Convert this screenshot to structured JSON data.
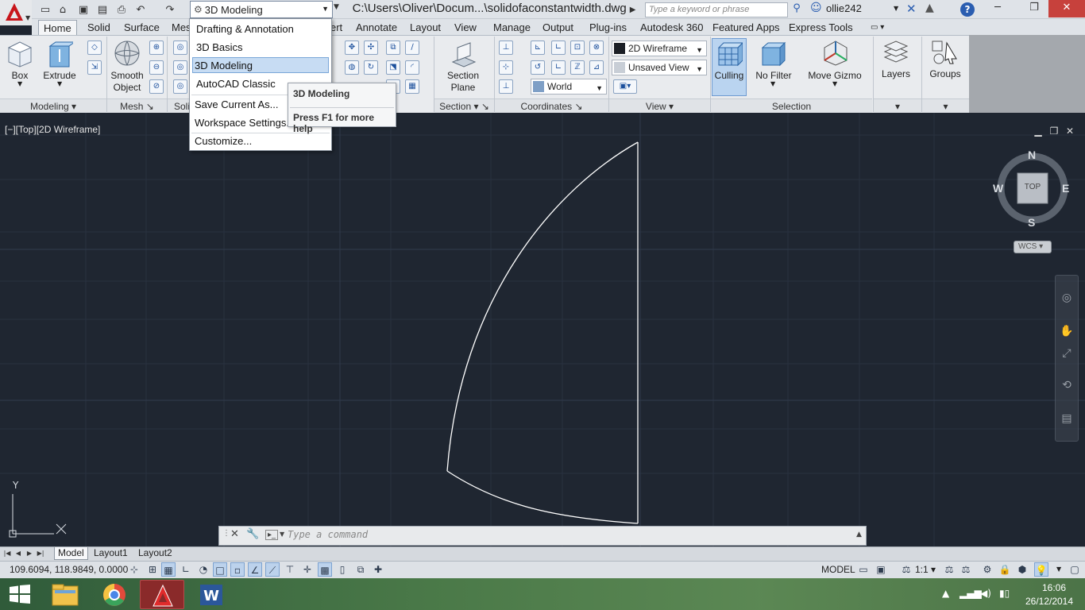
{
  "titlebar": {
    "workspace_current": "3D Modeling",
    "file_title": "C:\\Users\\Oliver\\Docum...\\solidofaconstantwidth.dwg",
    "search_placeholder": "Type a keyword or phrase",
    "user_name": "ollie242"
  },
  "tabs": [
    {
      "label": "Home"
    },
    {
      "label": "Solid"
    },
    {
      "label": "Surface"
    },
    {
      "label": "Mes"
    },
    {
      "label": "ert"
    },
    {
      "label": "Annotate"
    },
    {
      "label": "Layout"
    },
    {
      "label": "View"
    },
    {
      "label": "Manage"
    },
    {
      "label": "Output"
    },
    {
      "label": "Plug-ins"
    },
    {
      "label": "Autodesk 360"
    },
    {
      "label": "Featured Apps"
    },
    {
      "label": "Express Tools"
    }
  ],
  "ribbon": {
    "box": "Box",
    "extrude": "Extrude",
    "smooth_object_1": "Smooth",
    "smooth_object_2": "Object",
    "section_plane_1": "Section",
    "section_plane_2": "Plane",
    "visual_style": "2D Wireframe",
    "view": "Unsaved View",
    "ucs": "World",
    "culling": "Culling",
    "no_filter": "No Filter",
    "move_gizmo": "Move Gizmo",
    "layers": "Layers",
    "groups": "Groups",
    "panels": {
      "modeling": "Modeling",
      "mesh": "Mesh",
      "soli": "Soli",
      "section": "Section",
      "coordinates": "Coordinates",
      "view": "View",
      "selection": "Selection"
    }
  },
  "workspace_menu": {
    "items": [
      "Drafting & Annotation",
      "3D Basics",
      "3D Modeling",
      "AutoCAD Classic"
    ],
    "actions": [
      "Save Current As...",
      "Workspace Settings...",
      "Customize..."
    ]
  },
  "tooltip": {
    "title": "3D Modeling",
    "help": "Press F1 for more help"
  },
  "viewport": {
    "label": "[−][Top][2D Wireframe]",
    "compass": {
      "n": "N",
      "s": "S",
      "e": "E",
      "w": "W",
      "face": "TOP"
    },
    "wcs": "WCS",
    "ucs_x": "X",
    "ucs_y": "Y"
  },
  "command": {
    "placeholder": "Type  a  command"
  },
  "layout_tabs": [
    "Model",
    "Layout1",
    "Layout2"
  ],
  "status": {
    "coords": "109.6094, 118.9849, 0.0000",
    "space": "MODEL",
    "scale": "1:1"
  },
  "taskbar": {
    "time": "16:06",
    "date": "26/12/2014"
  },
  "colors": {
    "drawing_bg": "#1f2631",
    "geometry": "#ffffff",
    "accent": "#2a5db0"
  }
}
